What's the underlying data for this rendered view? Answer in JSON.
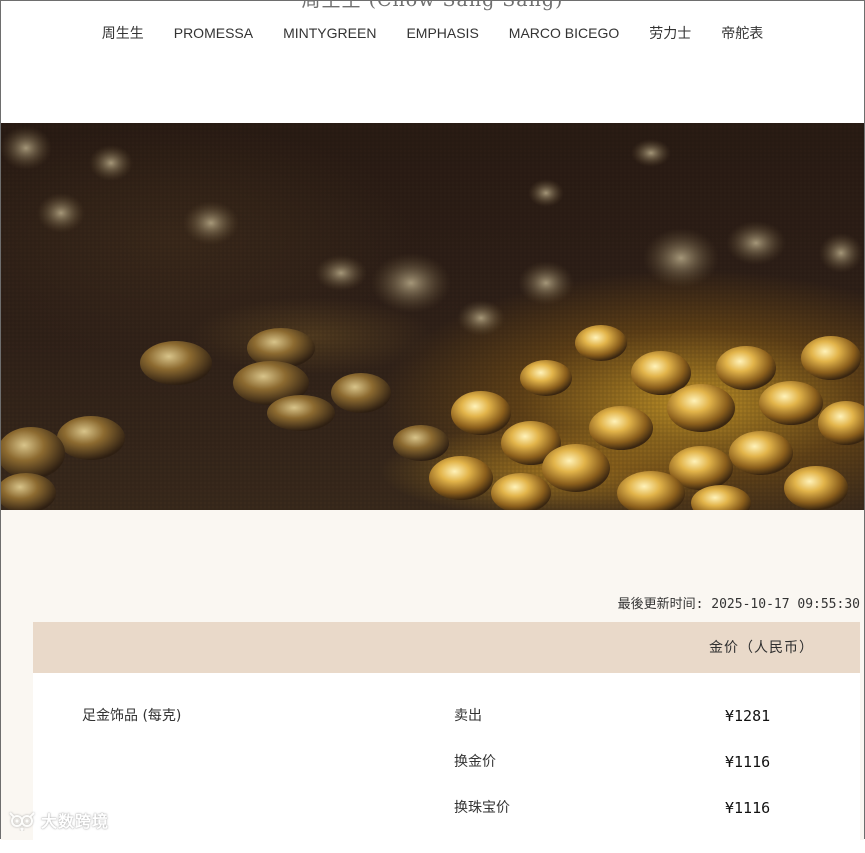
{
  "header": {
    "logo": "周生生 (Chow Sang Sang)",
    "nav": [
      {
        "label": "周生生"
      },
      {
        "label": "PROMESSA"
      },
      {
        "label": "MINTYGREEN"
      },
      {
        "label": "EMPHASIS"
      },
      {
        "label": "MARCO BICEGO"
      },
      {
        "label": "劳力士"
      },
      {
        "label": "帝舵表"
      }
    ]
  },
  "hero": {
    "image": "gold-grains-banner"
  },
  "prices": {
    "updated": "最後更新时间: 2025-10-17 09:55:30",
    "column_header": "金价（人民币）",
    "product": "足金饰品 (每克)",
    "rows": [
      {
        "label": "卖出",
        "value": "¥1281"
      },
      {
        "label": "换金价",
        "value": "¥1116"
      },
      {
        "label": "换珠宝价",
        "value": "¥1116"
      }
    ]
  },
  "watermark": {
    "text": "大数跨境",
    "icon": "owl-logo-icon"
  }
}
